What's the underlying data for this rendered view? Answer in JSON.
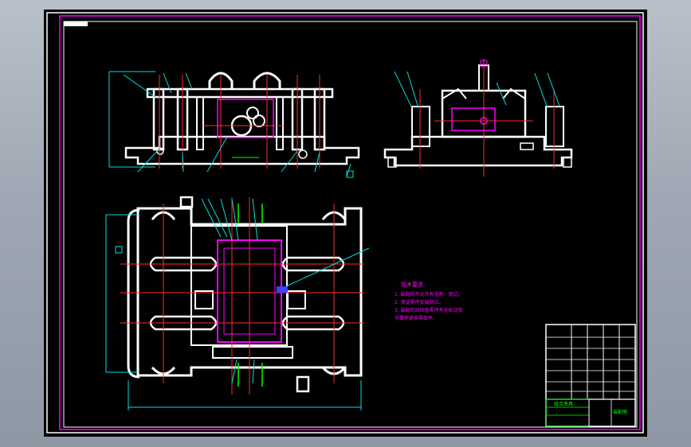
{
  "app": {
    "title": ""
  },
  "colors": {
    "background": "#000000",
    "frame_outer": "#ffffff",
    "frame_inner": "#ff00ff",
    "part": "#ffffff",
    "centerline": "#ff2a2a",
    "dimension": "#00e0e0",
    "dimension_text": "#ffff00",
    "highlight": "#ff00ff",
    "accent_green": "#00ff00",
    "accent_blue": "#4040ff"
  },
  "notes": {
    "heading": "技术要求",
    "lines": [
      "1. 装配前不允许有毛刺、锐边。",
      "2. 保证零件安装到位。",
      "3. 装配完后检查零件有无松动及",
      "   可靠夹紧各零部件。"
    ]
  },
  "title_block": {
    "drawing_title": "组合夹具",
    "subtitle": "装配图"
  },
  "dimensions": {
    "overall_width": "",
    "overall_height": ""
  }
}
